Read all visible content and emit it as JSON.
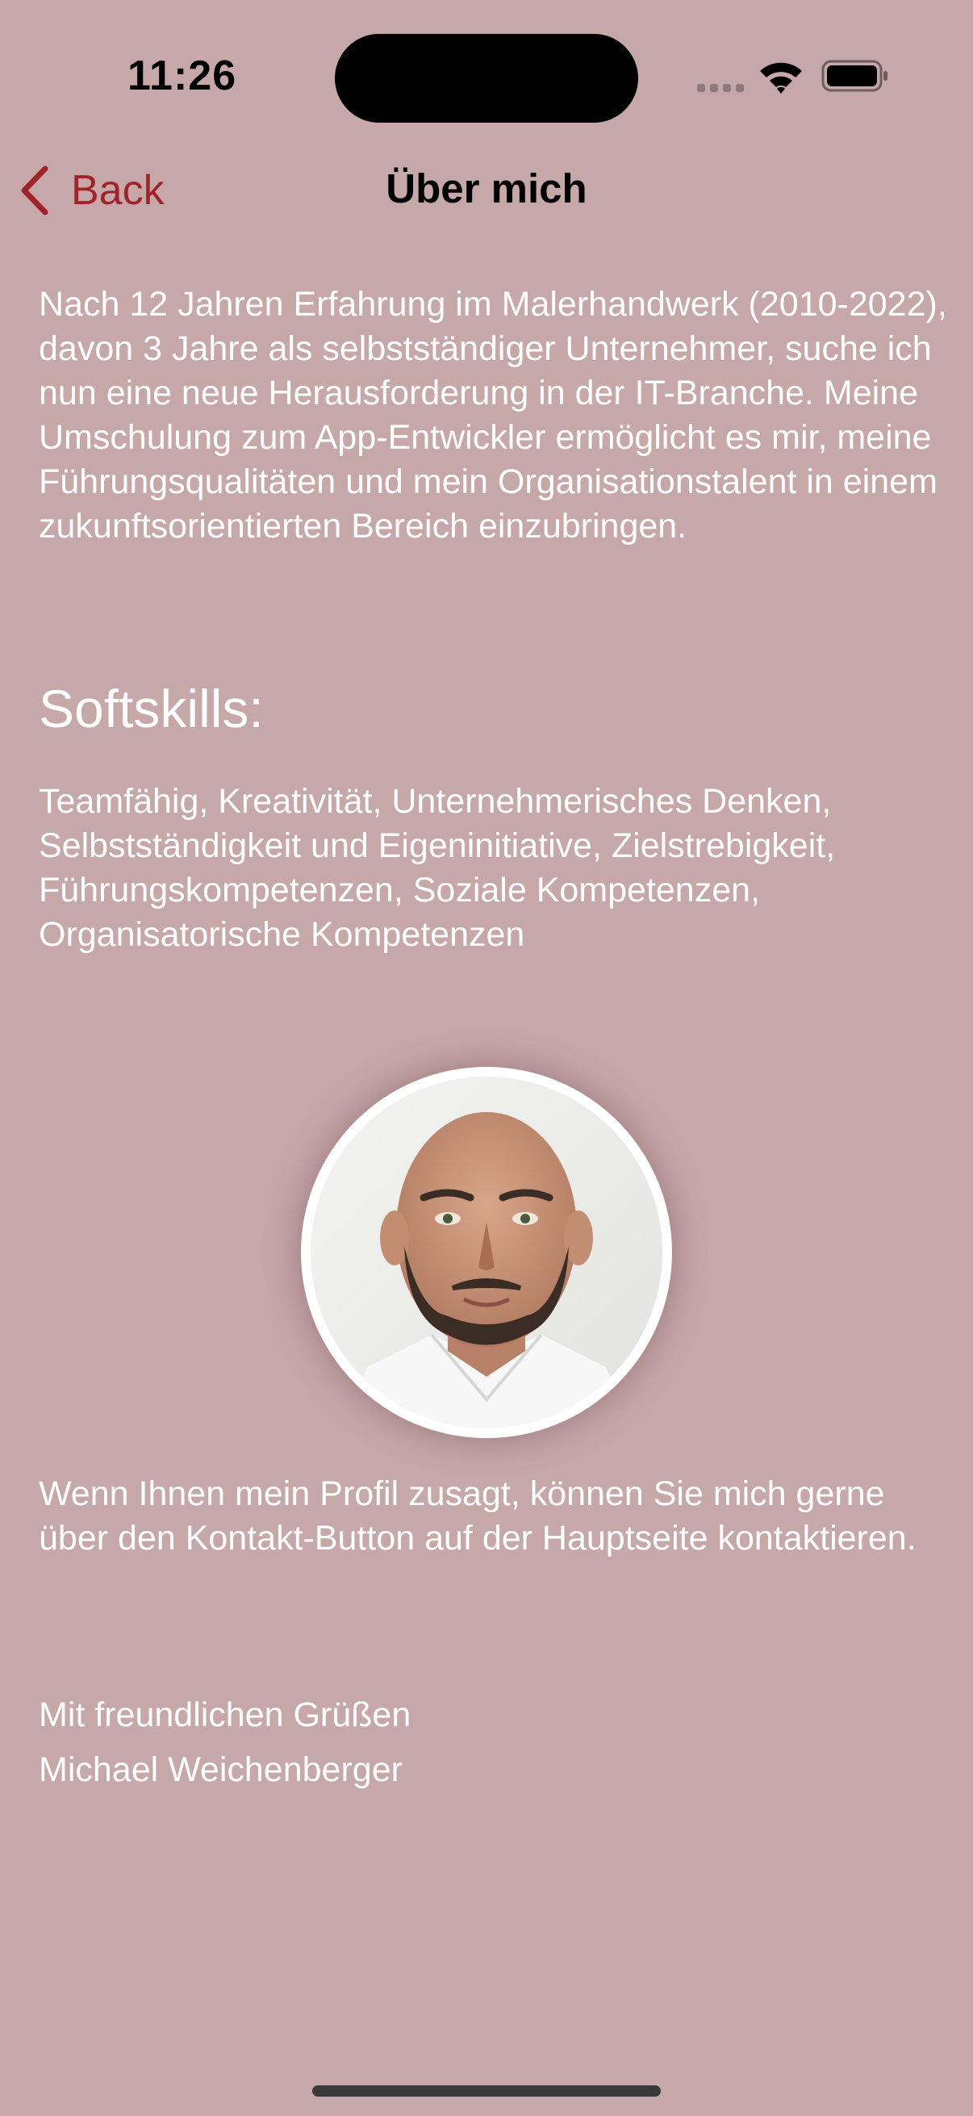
{
  "status_bar": {
    "time": "11:26",
    "icons": [
      "signal-icon",
      "wifi-icon",
      "battery-icon"
    ]
  },
  "nav": {
    "back_label": "Back",
    "title": "Über mich",
    "back_icon": "chevron-left-icon"
  },
  "content": {
    "intro": "Nach 12 Jahren Erfahrung im Malerhandwerk (2010-2022), davon 3 Jahre als selbstständiger Unternehmer, suche ich nun eine neue Herausforderung in der IT-Branche. Meine Umschulung zum App-Entwickler ermöglicht es mir, meine Führungsqualitäten und mein Organisationstalent in einem zukunftsorientierten Bereich einzubringen.",
    "softskills_heading": "Softskills:",
    "softskills": "Teamfähig, Kreativität, Unternehmerisches Denken, Selbstständigkeit und Eigeninitiative, Zielstrebigkeit, Führungskompetenzen, Soziale Kompetenzen, Organisatorische Kompetenzen",
    "closing": "Wenn Ihnen mein Profil zusagt, können Sie mich gerne über den Kontakt-Button auf der Hauptseite kontaktieren.",
    "greeting": "Mit freundlichen Grüßen",
    "signature": "Michael Weichenberger"
  },
  "colors": {
    "background": "#c7a8a9",
    "accent": "#a0232b",
    "text": "#ffffff"
  }
}
